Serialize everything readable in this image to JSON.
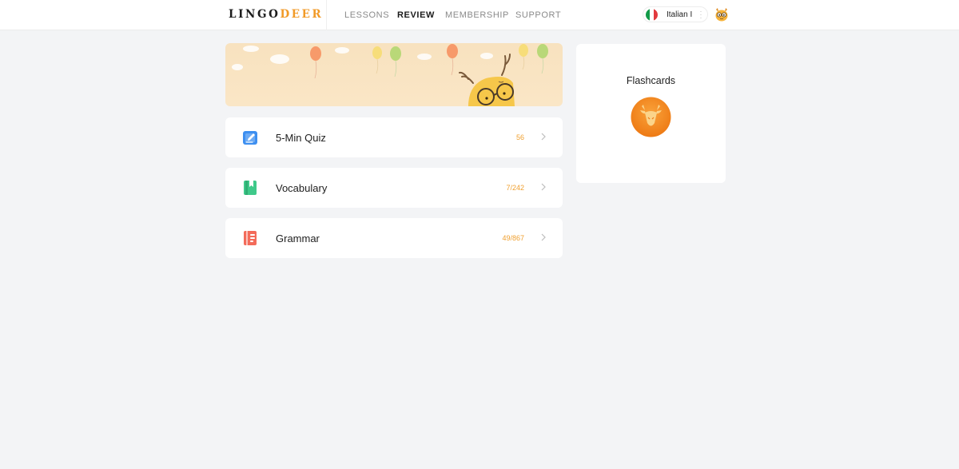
{
  "header": {
    "logo": {
      "part1": "LINGO",
      "part2": "DEER"
    },
    "nav": [
      "LESSONS",
      "REVIEW",
      "MEMBERSHIP",
      "SUPPORT"
    ],
    "active_nav": "REVIEW",
    "language": {
      "label": "Italian I",
      "flag_colors": [
        "#129a48",
        "#ffffff",
        "#e23a3e"
      ]
    }
  },
  "review_items": [
    {
      "label": "5-Min Quiz",
      "count": "56",
      "icon": "quiz-pencil-icon"
    },
    {
      "label": "Vocabulary",
      "count": "7/242",
      "icon": "vocabulary-book-icon"
    },
    {
      "label": "Grammar",
      "count": "49/867",
      "icon": "grammar-notebook-icon"
    }
  ],
  "flashcards": {
    "title": "Flashcards",
    "icon": "deer-head-icon"
  },
  "colors": {
    "accent": "#f19a27",
    "count": "#f0a030",
    "background": "#f3f4f6"
  }
}
